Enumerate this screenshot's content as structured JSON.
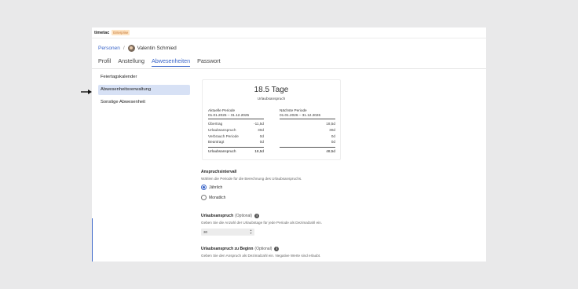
{
  "app": {
    "brand": "timetac",
    "badge": "Enterprise"
  },
  "breadcrumb": {
    "root": "Personen",
    "separator": "/",
    "person": "Valentin Schmied"
  },
  "tabs": [
    {
      "label": "Profil"
    },
    {
      "label": "Anstellung"
    },
    {
      "label": "Abwesenheiten",
      "active": true
    },
    {
      "label": "Passwort"
    }
  ],
  "sidebar": {
    "items": [
      {
        "label": "Feiertagskalender"
      },
      {
        "label": "Abwesenheitsverwaltung",
        "selected": true
      },
      {
        "label": "Sonstige Abwesenheit"
      }
    ]
  },
  "summary": {
    "total": "18.5 Tage",
    "caption": "Urlaubsanspruch",
    "current": {
      "title": "Aktuelle Periode",
      "range": "01.01.2025 – 31.12.2025",
      "rows": [
        {
          "label": "Übertrag",
          "value": "-11,5d"
        },
        {
          "label": "Urlaubsanspruch",
          "value": "30d"
        },
        {
          "label": "Verbrauch Periode",
          "value": "0d"
        },
        {
          "label": "Beantragt",
          "value": "0d"
        }
      ],
      "total_label": "Urlaubsanspruch",
      "total_value": "18,5d"
    },
    "next": {
      "title": "Nächste Periode",
      "range": "01.01.2026 – 31.12.2026",
      "rows": [
        {
          "value": "18,5d"
        },
        {
          "value": "30d"
        },
        {
          "value": "0d"
        },
        {
          "value": "0d"
        }
      ],
      "total_value": "48,5d"
    }
  },
  "interval": {
    "label": "Anspruchsintervall",
    "help": "Wählen die Periode für die Berechnung des Urlaubsanspruchs.",
    "options": [
      {
        "label": "Jährlich",
        "checked": true
      },
      {
        "label": "Monatlich",
        "checked": false
      }
    ]
  },
  "entitlement": {
    "label": "Urlaubsanspruch",
    "optional": "(Optional)",
    "help": "Geben Sie die Anzahl der Urlaubstage für jede Periode als Dezimalzahl ein.",
    "value": "30"
  },
  "initial": {
    "label": "Urlaubsanspruch zu Beginn",
    "optional": "(Optional)",
    "help": "Geben Sie den Anspruch als Dezimalzahl ein. Negative Werte sind erlaubt."
  },
  "colors": {
    "accent": "#3b66c9",
    "selected_bg": "#d7e1f5",
    "badge_bg": "#fde4c4"
  }
}
